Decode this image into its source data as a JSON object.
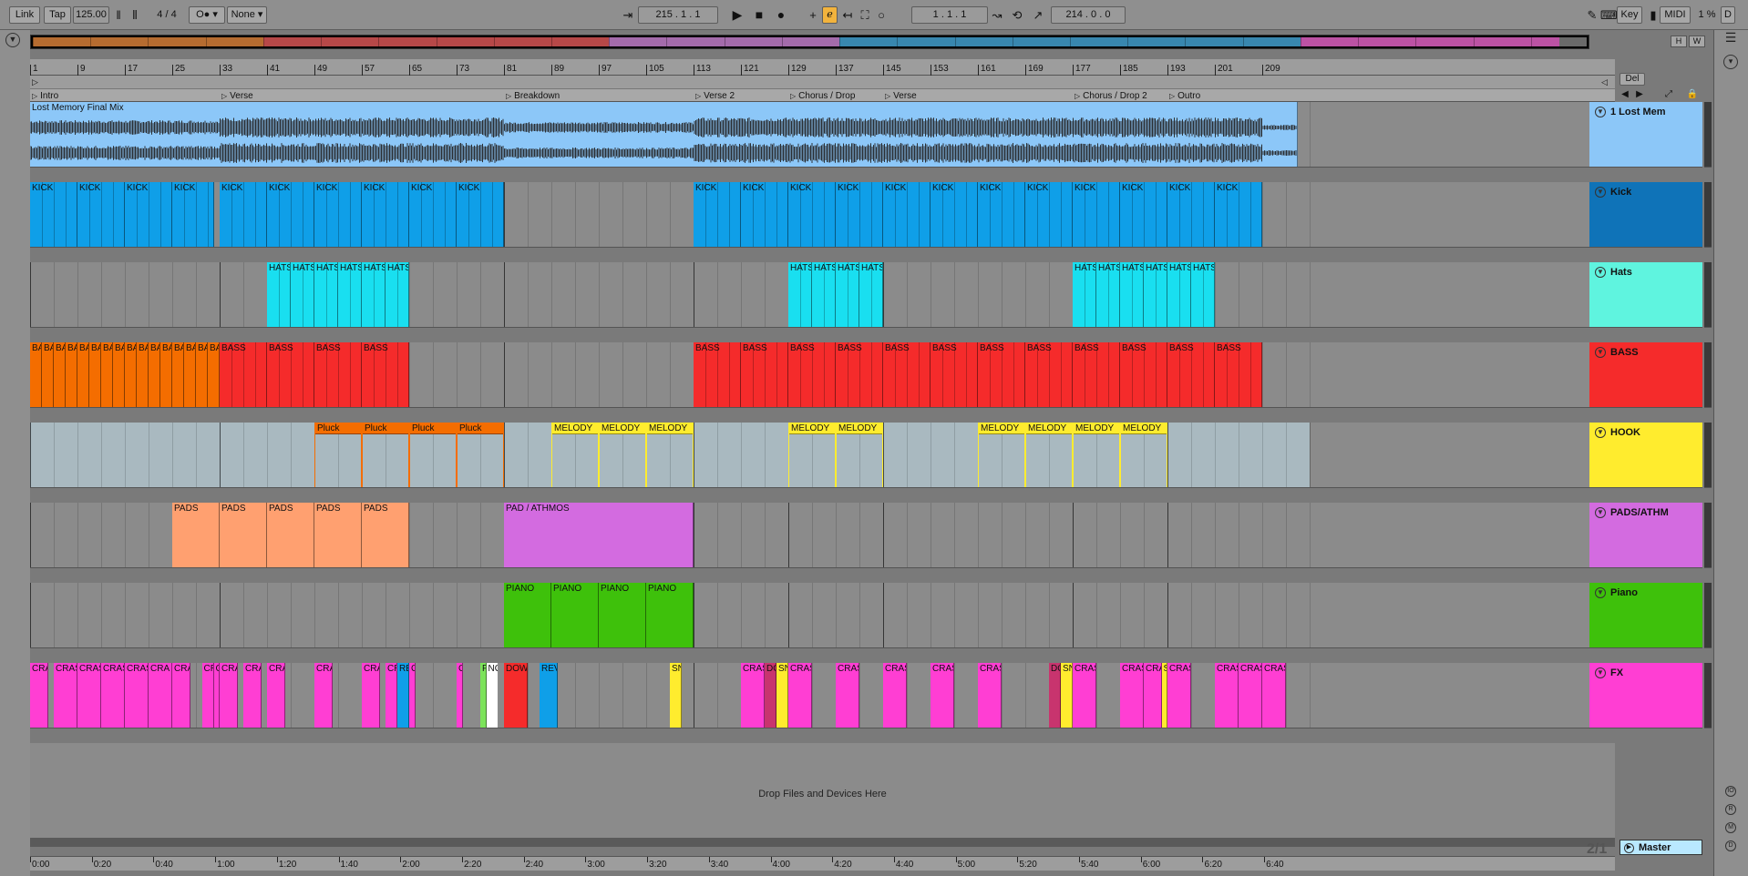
{
  "toolbar": {
    "link": "Link",
    "tap": "Tap",
    "tempo": "125.00",
    "time_sig_num": "4",
    "time_sig_sep": "/",
    "time_sig_den": "4",
    "quantize": "None",
    "metro": "O●",
    "position_bar": "215",
    "position_beat": "1",
    "position_sixteenth": "1",
    "loop_start_bar": "1",
    "loop_start_beat": "1",
    "loop_start_sixteenth": "1",
    "loop_length_bar": "214",
    "loop_length_beat": "0",
    "loop_length_sixteenth": "0",
    "key": "Key",
    "midi": "MIDI",
    "cpu": "1 %",
    "disk": "D"
  },
  "overview_buttons": {
    "h": "H",
    "w": "W"
  },
  "header_buttons": {
    "del": "Del"
  },
  "colors": {
    "audio": "#8cc7f8",
    "kick": "#0f9fe8",
    "hats": "#19dff0",
    "bass": "#f52b2b",
    "bass_intro": "#f46d00",
    "pluck": "#f46d00",
    "melody": "#ffec2e",
    "pads": "#ffa070",
    "pad_athmos": "#d36be0",
    "piano": "#3ec10b",
    "fx": "#ff3ed3",
    "hook_lane": "#a9b9c0"
  },
  "bar_numbers": [
    "1",
    "9",
    "17",
    "25",
    "33",
    "41",
    "49",
    "57",
    "65",
    "73",
    "81",
    "89",
    "97",
    "105",
    "113",
    "121",
    "129",
    "137",
    "145",
    "153",
    "161",
    "169",
    "177",
    "185",
    "193",
    "201",
    "209"
  ],
  "sections": [
    {
      "name": "Intro",
      "bar": 1
    },
    {
      "name": "Verse",
      "bar": 33
    },
    {
      "name": "Breakdown",
      "bar": 81
    },
    {
      "name": "Verse 2",
      "bar": 113
    },
    {
      "name": "Chorus / Drop",
      "bar": 129
    },
    {
      "name": "Verse",
      "bar": 145
    },
    {
      "name": "Chorus / Drop 2",
      "bar": 177
    },
    {
      "name": "Outro",
      "bar": 193
    }
  ],
  "tracks": [
    {
      "name": "1 Lost Mem",
      "color": "#8cc7f8",
      "height": 72
    },
    {
      "name": "Kick",
      "color": "#0f73b8",
      "height": 72
    },
    {
      "name": "Hats",
      "color": "#5ff4df",
      "height": 72
    },
    {
      "name": "BASS",
      "color": "#f52b2b",
      "height": 72
    },
    {
      "name": "HOOK",
      "color": "#ffec2e",
      "height": 72
    },
    {
      "name": "PADS/ATHM",
      "color": "#d36be0",
      "height": 72
    },
    {
      "name": "Piano",
      "color": "#3ec10b",
      "height": 72
    },
    {
      "name": "FX",
      "color": "#ff3ed3",
      "height": 72
    }
  ],
  "audio_clip": {
    "name": "Lost Memory Final Mix"
  },
  "clip_labels": {
    "kick": "KICK",
    "hats": "HATS",
    "bass": "BASS",
    "ba": "BA",
    "pluck": "Pluck",
    "melody": "MELODY",
    "pads": "PADS",
    "pad_athmos": "PAD / ATHMOS",
    "piano": "PIANO",
    "crash": "CRASH",
    "cra": "CRA",
    "cr": "CR",
    "re": "RE",
    "c": "C",
    "f": "F",
    "no": "NO",
    "down": "DOWN",
    "reve": "REVE",
    "sn": "SN",
    "do": "DO",
    "s": "S"
  },
  "drop_text": "Drop Files and Devices Here",
  "master": {
    "name": "Master"
  },
  "zoom": "2/1",
  "time_labels": [
    "0:00",
    "0:20",
    "0:40",
    "1:00",
    "1:20",
    "1:40",
    "2:00",
    "2:20",
    "2:40",
    "3:00",
    "3:20",
    "3:40",
    "4:00",
    "4:20",
    "4:40",
    "5:00",
    "5:20",
    "5:40",
    "6:00",
    "6:20",
    "6:40"
  ]
}
